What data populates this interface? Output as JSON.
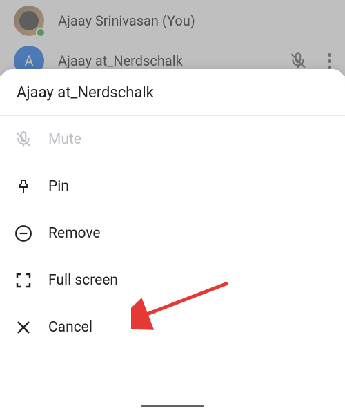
{
  "background": {
    "participant1": {
      "name": "Ajaay Srinivasan (You)",
      "avatar_initial": ""
    },
    "participant2": {
      "name": "Ajaay at_Nerdschalk",
      "avatar_initial": "A"
    }
  },
  "sheet": {
    "title": "Ajaay at_Nerdschalk",
    "items": [
      {
        "label": "Mute",
        "icon": "mute-icon",
        "disabled": true
      },
      {
        "label": "Pin",
        "icon": "pin-icon",
        "disabled": false
      },
      {
        "label": "Remove",
        "icon": "remove-icon",
        "disabled": false
      },
      {
        "label": "Full screen",
        "icon": "fullscreen-icon",
        "disabled": false
      },
      {
        "label": "Cancel",
        "icon": "close-icon",
        "disabled": false
      }
    ]
  }
}
